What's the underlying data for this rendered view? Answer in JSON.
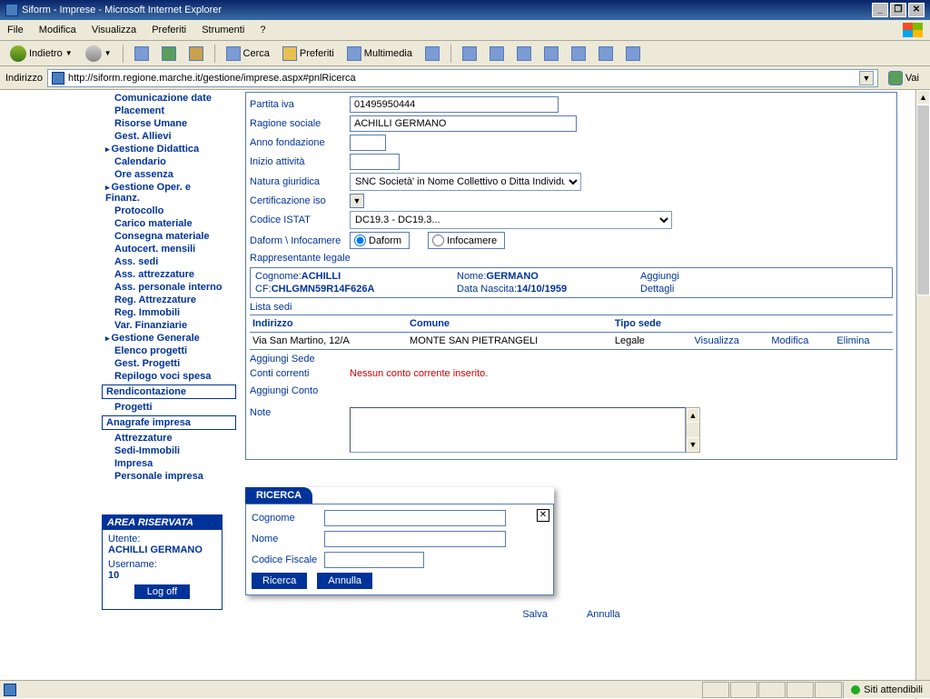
{
  "window": {
    "title": "Siform - Imprese - Microsoft Internet Explorer"
  },
  "menu": {
    "file": "File",
    "modifica": "Modifica",
    "visualizza": "Visualizza",
    "preferiti": "Preferiti",
    "strumenti": "Strumenti",
    "help": "?"
  },
  "toolbar": {
    "indietro": "Indietro",
    "cerca": "Cerca",
    "preferiti": "Preferiti",
    "multimedia": "Multimedia"
  },
  "address": {
    "label": "Indirizzo",
    "url": "http://siform.regione.marche.it/gestione/imprese.aspx#pnlRicerca",
    "go": "Vai"
  },
  "nav": {
    "items1": [
      "Comunicazione date",
      "Placement",
      "Risorse Umane",
      "Gest. Allievi"
    ],
    "h1": "Gestione Didattica",
    "items2": [
      "Calendario",
      "Ore assenza"
    ],
    "h2": "Gestione Oper. e Finanz.",
    "items3": [
      "Protocollo",
      "Carico materiale",
      "Consegna materiale",
      "Autocert. mensili",
      "Ass. sedi",
      "Ass. attrezzature",
      "Ass. personale interno",
      "Reg. Attrezzature",
      "Reg. Immobili",
      "Var. Finanziarie"
    ],
    "h3": "Gestione Generale",
    "items4": [
      "Elenco progetti",
      "Gest. Progetti",
      "Repilogo voci spesa"
    ],
    "box1": "Rendicontazione",
    "items5": [
      "Progetti"
    ],
    "box2": "Anagrafe impresa",
    "items6": [
      "Attrezzature",
      "Sedi-Immobili",
      "Impresa",
      "Personale impresa"
    ]
  },
  "area": {
    "title": "AREA RISERVATA",
    "utente_label": "Utente:",
    "utente_value": "ACHILLI GERMANO",
    "username_label": "Username:",
    "username_value": "10",
    "logoff": "Log off"
  },
  "form": {
    "partita_iva": {
      "label": "Partita iva",
      "value": "01495950444"
    },
    "ragione_sociale": {
      "label": "Ragione sociale",
      "value": "ACHILLI GERMANO"
    },
    "anno_fondazione": {
      "label": "Anno fondazione",
      "value": ""
    },
    "inizio_attivita": {
      "label": "Inizio attività",
      "value": ""
    },
    "natura_giuridica": {
      "label": "Natura giuridica",
      "value": "SNC Società' in Nome Collettivo o Ditta Individuale"
    },
    "certificazione_iso": {
      "label": "Certificazione iso"
    },
    "codice_istat": {
      "label": "Codice ISTAT",
      "value": "DC19.3 - DC19.3..."
    },
    "daform_infocamere": {
      "label": "Daform \\ Infocamere",
      "opt1": "Daform",
      "opt2": "Infocamere"
    },
    "rappresentante": {
      "title": "Rappresentante legale",
      "cognome_label": "Cognome:",
      "cognome_value": "ACHILLI",
      "cf_label": "CF:",
      "cf_value": "CHLGMN59R14F626A",
      "nome_label": "Nome:",
      "nome_value": "GERMANO",
      "data_label": "Data Nascita:",
      "data_value": "14/10/1959",
      "aggiungi": "Aggiungi",
      "dettagli": "Dettagli"
    },
    "sedi": {
      "title": "Lista sedi",
      "col1": "Indirizzo",
      "col2": "Comune",
      "col3": "Tipo sede",
      "row1_addr": "Via San Martino, 12/A",
      "row1_comune": "MONTE SAN PIETRANGELI",
      "row1_tipo": "Legale",
      "visualizza": "Visualizza",
      "modifica": "Modifica",
      "elimina": "Elimina",
      "aggiungi_sede": "Aggiungi Sede"
    },
    "conti": {
      "label": "Conti correnti",
      "msg": "Nessun conto corrente inserito.",
      "aggiungi": "Aggiungi Conto"
    },
    "note_label": "Note"
  },
  "ricerca": {
    "title": "RICERCA",
    "cognome": "Cognome",
    "nome": "Nome",
    "cf": "Codice Fiscale",
    "btn_ricerca": "Ricerca",
    "btn_annulla": "Annulla"
  },
  "footer": {
    "salva": "Salva",
    "annulla": "Annulla"
  },
  "status": {
    "trusted": "Siti attendibili"
  }
}
